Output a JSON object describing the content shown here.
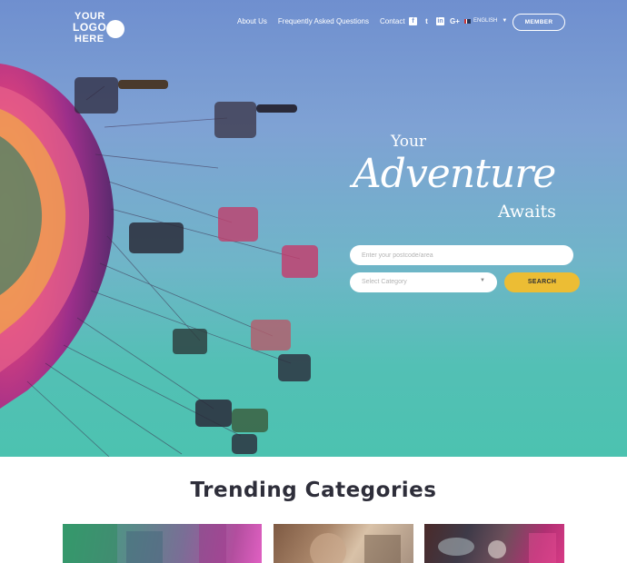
{
  "header": {
    "logo": {
      "line1": "YOUR",
      "line2": "LOGO",
      "line3": "HERE"
    },
    "nav": [
      {
        "label": "About Us"
      },
      {
        "label": "Frequently Asked Questions"
      },
      {
        "label": "Contact"
      }
    ],
    "social": [
      {
        "icon": "facebook-icon",
        "glyph": "f"
      },
      {
        "icon": "twitter-icon",
        "glyph": "t"
      },
      {
        "icon": "linkedin-icon",
        "glyph": "in"
      },
      {
        "icon": "google-plus-icon",
        "glyph": "G+"
      }
    ],
    "language": "ENGLISH",
    "member_label": "MEMBER"
  },
  "hero": {
    "tagline_top": "Your",
    "tagline_main": "Adventure",
    "tagline_bottom": "Awaits",
    "search": {
      "postcode_placeholder": "Enter your postcode/area",
      "category_selected": "Select Category",
      "button_label": "SEARCH"
    }
  },
  "trending": {
    "title": "Trending Categories"
  },
  "colors": {
    "accent": "#ecbd34",
    "title_text": "#2e2e3a",
    "sky_top": "#6f8fcf",
    "sky_bottom": "#4cc2b0"
  }
}
